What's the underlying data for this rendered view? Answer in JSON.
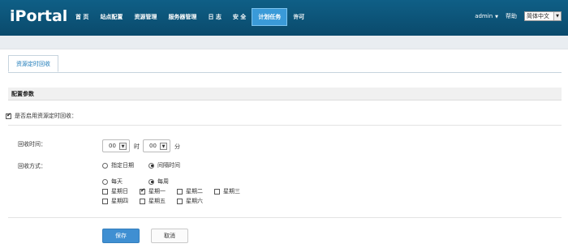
{
  "header": {
    "logo": "iPortal",
    "nav": [
      "首 页",
      "站点配置",
      "资源管理",
      "服务器管理",
      "日 志",
      "安 全",
      "计划任务",
      "许可"
    ],
    "active_nav": "计划任务",
    "user": "admin",
    "help": "帮助",
    "language": "简体中文"
  },
  "tab": {
    "label": "资源定时回收"
  },
  "section": {
    "title": "配置参数"
  },
  "enable": {
    "label": "是否启用资源定时回收：",
    "checked": true
  },
  "time": {
    "label": "回收时间：",
    "hour": "00",
    "hour_unit": "时",
    "minute": "00",
    "minute_unit": "分"
  },
  "method": {
    "label": "回收方式：",
    "options": [
      "指定日期",
      "间隔时间"
    ],
    "selected": "间隔时间"
  },
  "interval": {
    "options": [
      "每天",
      "每周"
    ],
    "selected": "每周"
  },
  "weekdays": {
    "row1": [
      "星期日",
      "星期一",
      "星期二",
      "星期三"
    ],
    "row2": [
      "星期四",
      "星期五",
      "星期六"
    ],
    "checked": [
      "星期一"
    ]
  },
  "actions": {
    "save": "保存",
    "cancel": "取消"
  },
  "colors": {
    "topbar": "#0a4a6c",
    "active_nav": "#3a9ad8",
    "primary_button": "#3f8fd2"
  }
}
